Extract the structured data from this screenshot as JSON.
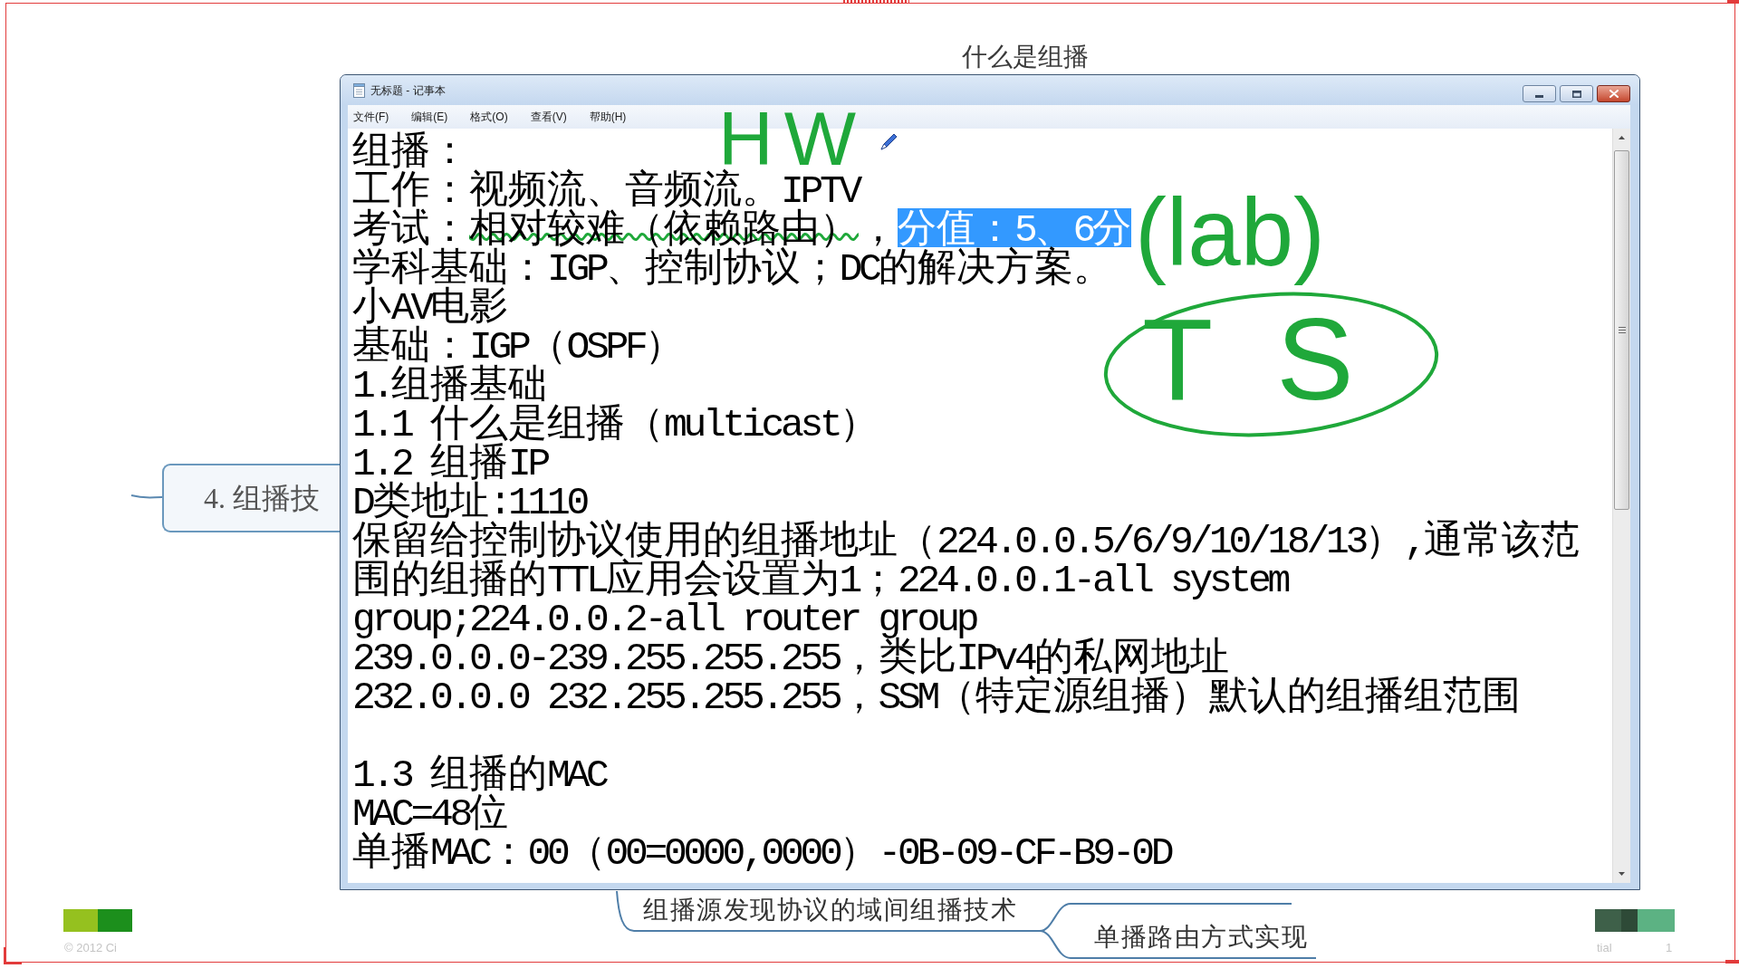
{
  "slide": {
    "title": "什么是组播",
    "footer_left": "© 2012 Ci",
    "footer_right": "tial",
    "page_number": "1"
  },
  "mind_map": {
    "nodes": [
      {
        "kind": "boxed",
        "label": "4. 组播技"
      },
      {
        "kind": "underlined",
        "label": "组播源发现协议的域间组播技术"
      },
      {
        "kind": "underlined",
        "label": "单播路由方式实现"
      }
    ]
  },
  "notepad": {
    "title": "无标题 - 记事本",
    "menu": [
      "文件(F)",
      "编辑(E)",
      "格式(O)",
      "查看(V)",
      "帮助(H)"
    ],
    "blocks": [
      [
        {
          "segments": [
            {
              "text": "组播：",
              "selected": false
            }
          ]
        },
        {
          "segments": [
            {
              "text": "工作：视频流、音频流。IPTV",
              "selected": false
            }
          ]
        },
        {
          "segments": [
            {
              "parts": [
                {
                  "text": "考试：",
                  "inked": false
                },
                {
                  "text": "相对较难（依赖路由）",
                  "inked": true
                },
                {
                  "text": "，",
                  "inked": false
                }
              ],
              "selected": false
            },
            {
              "text": "分值：5、6分",
              "selected": true
            }
          ]
        },
        {
          "segments": [
            {
              "text": "学科基础：IGP、控制协议；DC的解决方案。",
              "selected": false
            }
          ]
        },
        {
          "segments": [
            {
              "text": "小AV电影",
              "selected": false
            }
          ]
        },
        {
          "segments": [
            {
              "text": "基础：IGP（OSPF）",
              "selected": false
            }
          ]
        },
        {
          "segments": [
            {
              "text": "1.组播基础",
              "selected": false
            }
          ]
        },
        {
          "segments": [
            {
              "text": "1.1 什么是组播（multicast）",
              "selected": false
            }
          ]
        },
        {
          "segments": [
            {
              "text": "1.2 组播IP",
              "selected": false
            }
          ]
        },
        {
          "segments": [
            {
              "text": "D类地址:1110",
              "selected": false
            }
          ]
        },
        {
          "segments": [
            {
              "text": "保留给控制协议使用的组播地址（224.0.0.5/6/9/10/18/13）,通常该范",
              "selected": false
            }
          ]
        },
        {
          "segments": [
            {
              "text": "围的组播的TTL应用会设置为1；224.0.0.1-all system",
              "selected": false
            }
          ]
        },
        {
          "segments": [
            {
              "text": "group;224.0.0.2-all router group",
              "selected": false
            }
          ]
        },
        {
          "segments": [
            {
              "text": "239.0.0.0-239.255.255.255，类比IPv4的私网地址",
              "selected": false
            }
          ]
        },
        {
          "segments": [
            {
              "text": "232.0.0.0 232.255.255.255，SSM（特定源组播）默认的组播组范围",
              "selected": false
            }
          ]
        }
      ],
      [
        {
          "segments": [
            {
              "text": "1.3 组播的MAC",
              "selected": false
            }
          ]
        },
        {
          "segments": [
            {
              "text": "MAC=48位",
              "selected": false
            }
          ]
        },
        {
          "segments": [
            {
              "text": "单播MAC：00（00=0000,0000）-0B-09-CF-B9-0D",
              "selected": false
            }
          ]
        }
      ]
    ]
  },
  "ink": {
    "notes": [
      {
        "text": "HW",
        "circled": false
      },
      {
        "text": "(lab)",
        "circled": false
      },
      {
        "text": "TS",
        "circled": true
      }
    ]
  }
}
